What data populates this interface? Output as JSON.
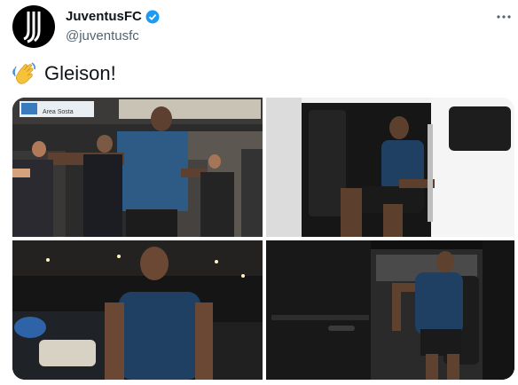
{
  "tweet": {
    "author": {
      "display_name": "JuventusFC",
      "handle": "@juventusfc",
      "verified_icon": "verified-badge-icon",
      "avatar_icon": "juventus-logo-icon"
    },
    "text": "Gleison!",
    "emoji_icon": "waving-hand-icon",
    "more_icon": "more-dots-icon"
  },
  "media": {
    "photos": [
      {
        "subject": "airport-arrival-photo",
        "sign_text": "Area Sosta"
      },
      {
        "subject": "car-seat-photo"
      },
      {
        "subject": "night-walk-photo"
      },
      {
        "subject": "car-exit-photo"
      }
    ]
  },
  "colors": {
    "verified": "#1d9bf0",
    "text": "#0f1419",
    "secondary": "#536471",
    "shirt": "#1f3f63",
    "skin": "#6b4a35"
  }
}
